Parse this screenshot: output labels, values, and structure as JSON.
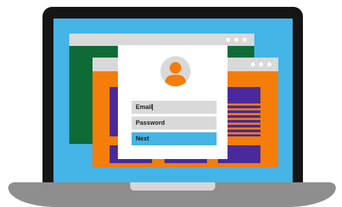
{
  "login": {
    "email_placeholder": "Email",
    "password_placeholder": "Password",
    "next_label": "Next"
  },
  "icons": {
    "avatar": "user-avatar-icon",
    "window_controls": "three-dots-icon"
  },
  "colors": {
    "screen": "#45b4e6",
    "back_window": "#0e6b36",
    "front_window": "#f57d0a",
    "content_blocks": "#4a2a9a",
    "accent_button": "#45b4e6",
    "field_background": "#d9d9d9"
  }
}
